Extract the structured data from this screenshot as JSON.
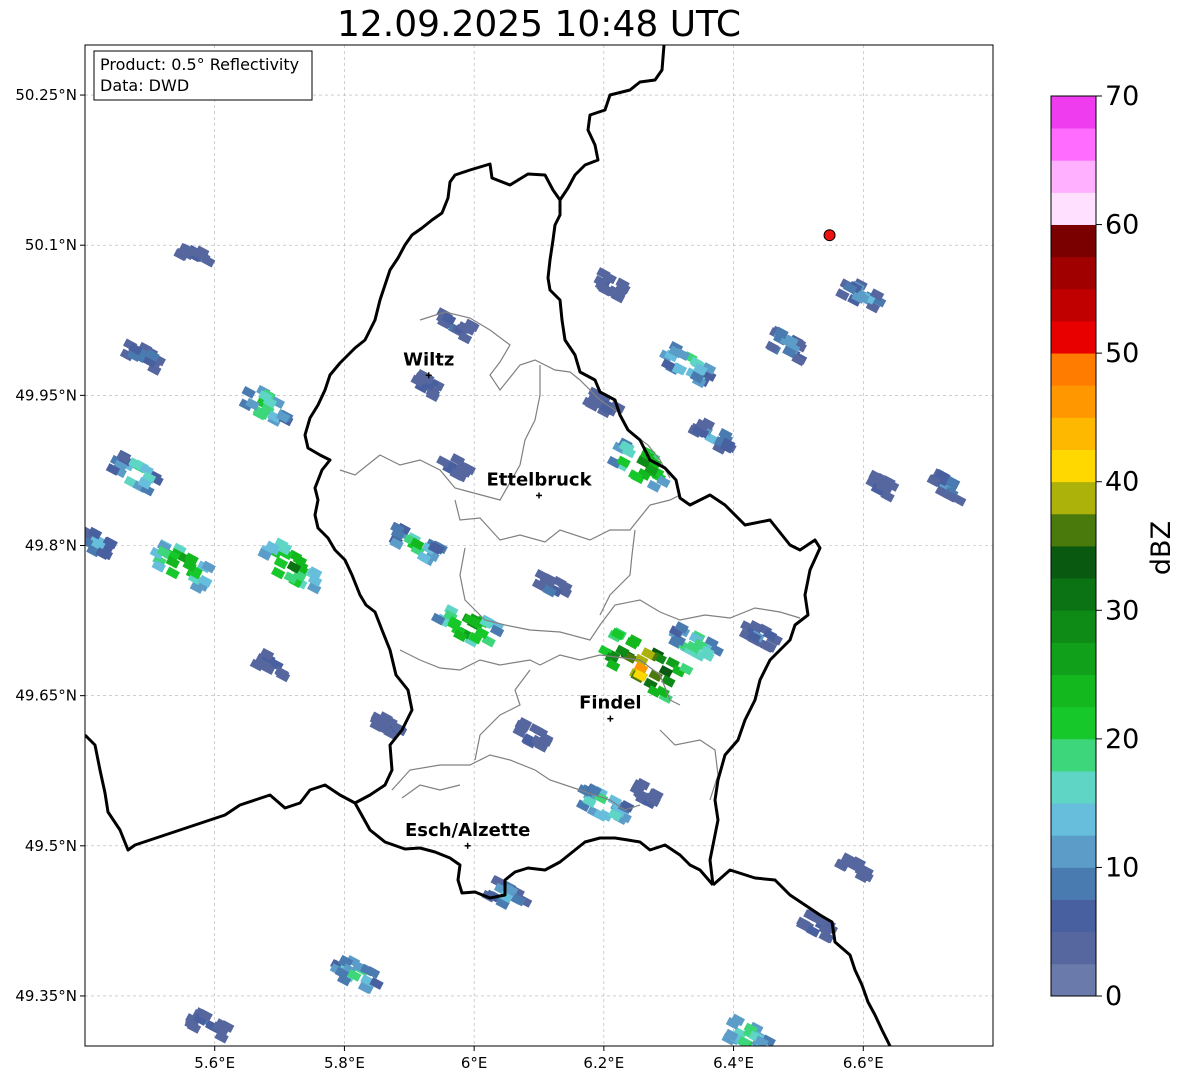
{
  "title": "12.09.2025 10:48 UTC",
  "info_box": {
    "line1": "Product: 0.5° Reflectivity",
    "line2": "Data: DWD"
  },
  "axes": {
    "x_ticks": [
      "5.6°E",
      "5.8°E",
      "6°E",
      "6.2°E",
      "6.4°E",
      "6.6°E"
    ],
    "y_ticks": [
      "50.25°N",
      "50.1°N",
      "49.95°N",
      "49.8°N",
      "49.65°N",
      "49.5°N",
      "49.35°N"
    ]
  },
  "cities": [
    {
      "name": "Wiltz",
      "lon": 5.93,
      "lat": 49.97
    },
    {
      "name": "Ettelbruck",
      "lon": 6.1,
      "lat": 49.85
    },
    {
      "name": "Findel",
      "lon": 6.21,
      "lat": 49.627
    },
    {
      "name": "Esch/Alzette",
      "lon": 5.99,
      "lat": 49.5
    }
  ],
  "radar_site": {
    "lon": 6.548,
    "lat": 50.11,
    "color": "#ee1111"
  },
  "colorbar": {
    "label": "dBZ",
    "ticks": [
      "0",
      "10",
      "20",
      "30",
      "40",
      "50",
      "60",
      "70"
    ],
    "colors": [
      "#6a7aab",
      "#56679f",
      "#4860a0",
      "#4a7bb0",
      "#5b9dc8",
      "#66bedc",
      "#5fd6c5",
      "#3dd67a",
      "#16c82a",
      "#12b81e",
      "#10a01a",
      "#0e8a16",
      "#0c7314",
      "#095a10",
      "#4a7a0c",
      "#adb20a",
      "#ffd800",
      "#ffb800",
      "#ff9800",
      "#ff7c00",
      "#e80000",
      "#c00000",
      "#a00000",
      "#7a0000",
      "#ffe0ff",
      "#ffb0ff",
      "#ff6cff",
      "#ee3cee"
    ]
  },
  "chart_data": {
    "type": "map",
    "title": "12.09.2025 10:48 UTC",
    "xlim": [
      5.4,
      6.8
    ],
    "ylim": [
      49.3,
      50.3
    ],
    "x_ticks": [
      5.6,
      5.8,
      6.0,
      6.2,
      6.4,
      6.6
    ],
    "y_ticks": [
      50.25,
      50.1,
      49.95,
      49.8,
      49.65,
      49.5,
      49.35
    ],
    "grid": true,
    "colorbar_range": [
      0,
      70
    ],
    "colorbar_step": 2.5,
    "echo_cells": [
      {
        "lon": 5.57,
        "lat": 50.09,
        "dbz": 8
      },
      {
        "lon": 5.49,
        "lat": 49.99,
        "dbz": 12
      },
      {
        "lon": 5.48,
        "lat": 49.87,
        "dbz": 22
      },
      {
        "lon": 5.68,
        "lat": 49.94,
        "dbz": 22
      },
      {
        "lon": 5.55,
        "lat": 49.78,
        "dbz": 30
      },
      {
        "lon": 5.72,
        "lat": 49.78,
        "dbz": 30
      },
      {
        "lon": 5.42,
        "lat": 49.8,
        "dbz": 15
      },
      {
        "lon": 5.69,
        "lat": 49.68,
        "dbz": 8
      },
      {
        "lon": 5.97,
        "lat": 50.02,
        "dbz": 10
      },
      {
        "lon": 5.93,
        "lat": 49.96,
        "dbz": 8
      },
      {
        "lon": 5.97,
        "lat": 49.88,
        "dbz": 8
      },
      {
        "lon": 5.91,
        "lat": 49.8,
        "dbz": 22
      },
      {
        "lon": 5.99,
        "lat": 49.72,
        "dbz": 30
      },
      {
        "lon": 6.12,
        "lat": 49.76,
        "dbz": 8
      },
      {
        "lon": 5.87,
        "lat": 49.62,
        "dbz": 8
      },
      {
        "lon": 6.09,
        "lat": 49.61,
        "dbz": 8
      },
      {
        "lon": 6.21,
        "lat": 50.06,
        "dbz": 8
      },
      {
        "lon": 6.33,
        "lat": 49.98,
        "dbz": 22
      },
      {
        "lon": 6.26,
        "lat": 49.88,
        "dbz": 30
      },
      {
        "lon": 6.37,
        "lat": 49.91,
        "dbz": 15
      },
      {
        "lon": 6.2,
        "lat": 49.94,
        "dbz": 8
      },
      {
        "lon": 6.48,
        "lat": 50.0,
        "dbz": 15
      },
      {
        "lon": 6.6,
        "lat": 50.05,
        "dbz": 15
      },
      {
        "lon": 6.63,
        "lat": 49.86,
        "dbz": 8
      },
      {
        "lon": 6.73,
        "lat": 49.86,
        "dbz": 12
      },
      {
        "lon": 6.26,
        "lat": 49.68,
        "dbz": 45
      },
      {
        "lon": 6.34,
        "lat": 49.7,
        "dbz": 22
      },
      {
        "lon": 6.44,
        "lat": 49.71,
        "dbz": 10
      },
      {
        "lon": 6.2,
        "lat": 49.54,
        "dbz": 22
      },
      {
        "lon": 6.27,
        "lat": 49.55,
        "dbz": 8
      },
      {
        "lon": 6.05,
        "lat": 49.45,
        "dbz": 15
      },
      {
        "lon": 5.82,
        "lat": 49.37,
        "dbz": 20
      },
      {
        "lon": 5.59,
        "lat": 49.32,
        "dbz": 12
      },
      {
        "lon": 6.42,
        "lat": 49.31,
        "dbz": 22
      },
      {
        "lon": 6.59,
        "lat": 49.48,
        "dbz": 8
      },
      {
        "lon": 6.53,
        "lat": 49.42,
        "dbz": 8
      }
    ]
  }
}
